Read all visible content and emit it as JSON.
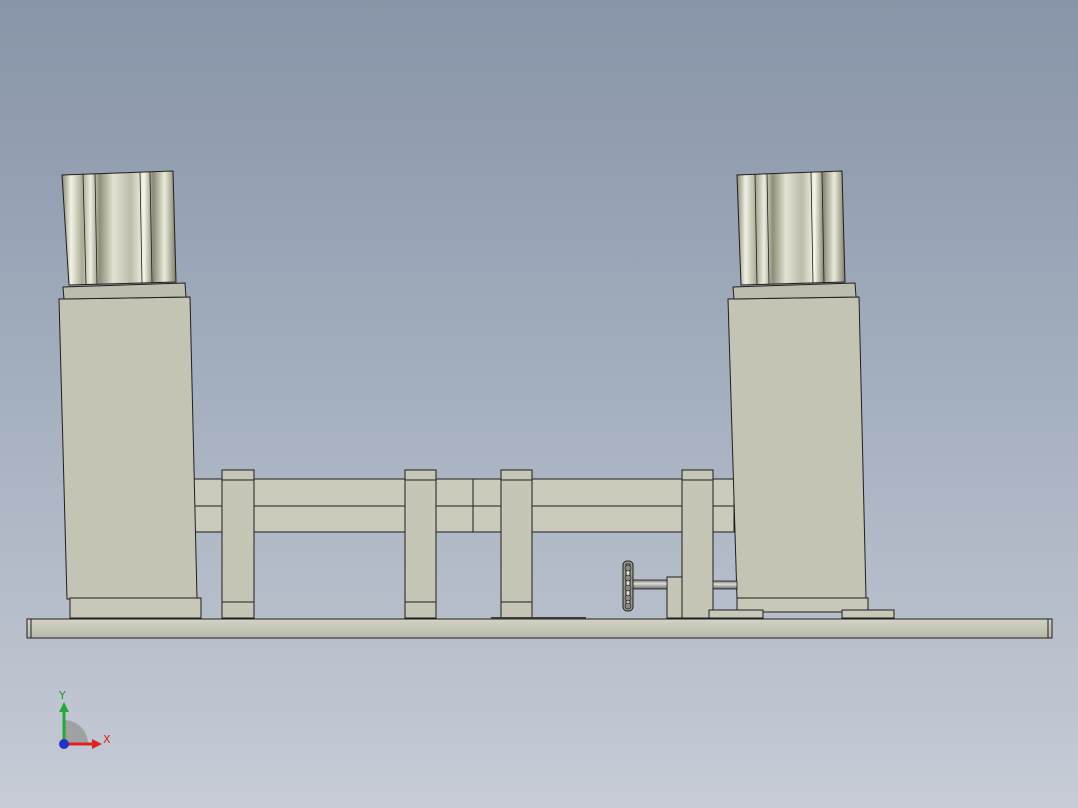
{
  "viewport": {
    "background_top": "#8895a8",
    "background_bottom": "#c7ccd6"
  },
  "model": {
    "part_color": "#c8c8b8",
    "edge_color": "#1e1e1e",
    "components": [
      "base-plate",
      "left-column",
      "right-column",
      "left-cylinder",
      "right-cylinder",
      "cross-rails",
      "support-blocks",
      "handwheel",
      "screw-shaft",
      "guide-block"
    ]
  },
  "triad": {
    "x_label": "X",
    "y_label": "Y",
    "x_color": "#dd2222",
    "y_color": "#22aa33",
    "z_color": "#2233cc"
  }
}
